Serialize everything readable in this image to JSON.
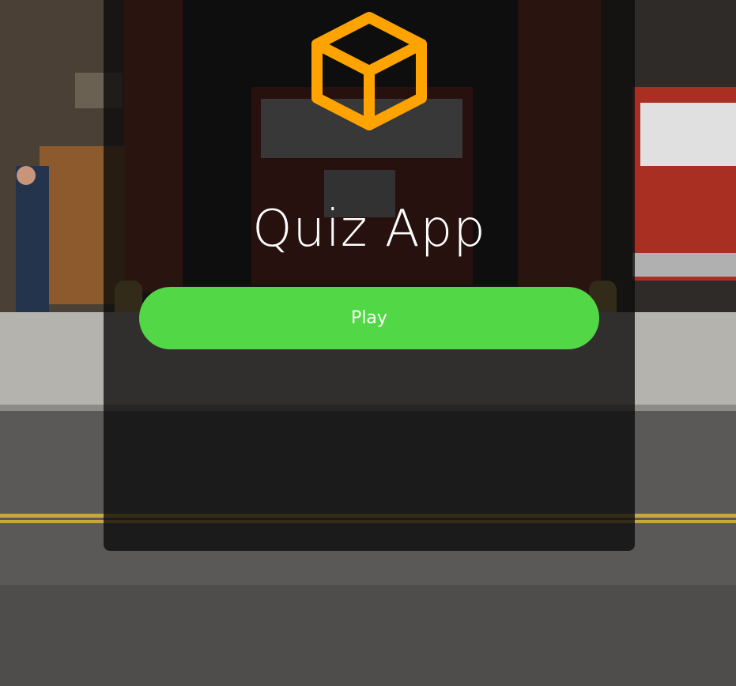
{
  "app": {
    "title": "Quiz App",
    "logo_icon": "cube-icon",
    "logo_color": "#ffa300"
  },
  "actions": {
    "play_label": "Play",
    "play_color": "#52d846"
  }
}
